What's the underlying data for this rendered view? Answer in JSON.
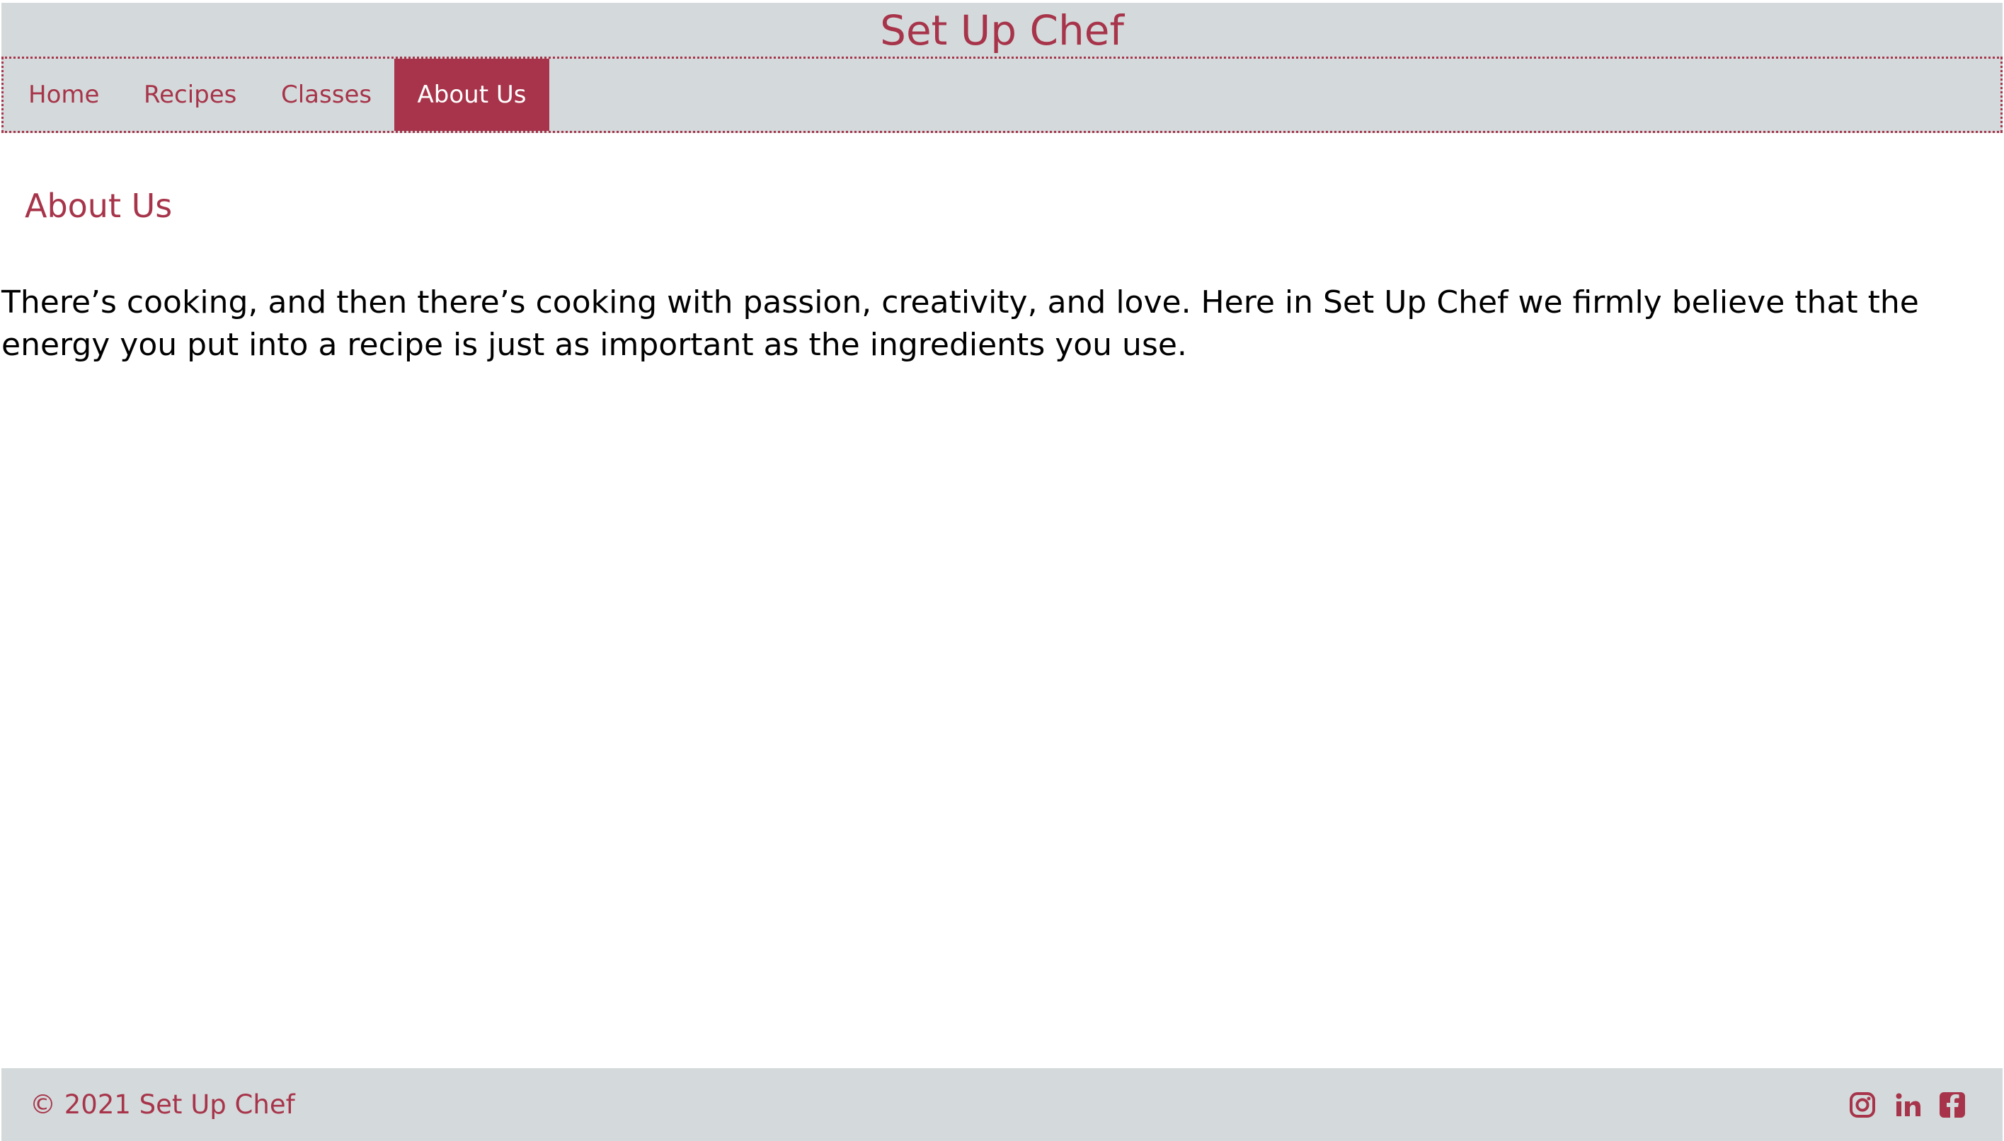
{
  "header": {
    "site_title": "Set Up Chef"
  },
  "nav": {
    "items": [
      {
        "label": "Home"
      },
      {
        "label": "Recipes"
      },
      {
        "label": "Classes"
      },
      {
        "label": "About Us"
      }
    ],
    "active": "About Us"
  },
  "main": {
    "heading": "About Us",
    "paragraph": "There’s cooking, and then there’s cooking with passion, creativity, and love. Here in Set Up Chef we firmly believe that the energy you put into a recipe is just as important as the ingredients you use."
  },
  "footer": {
    "copyright": "© 2021 Set Up Chef",
    "social_icons": [
      "instagram-icon",
      "linkedin-icon",
      "facebook-icon"
    ]
  },
  "colors": {
    "accent": "#a7344a",
    "bar_background": "#d4dadb",
    "page_background": "#ffffff",
    "text": "#000000"
  }
}
